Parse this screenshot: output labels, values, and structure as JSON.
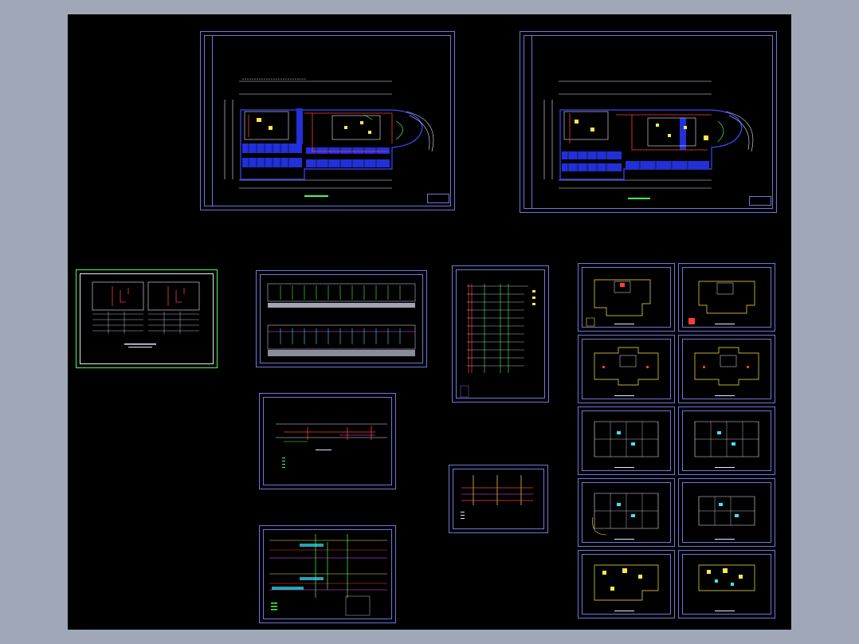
{
  "viewer": {
    "background": "#a0a8b7",
    "canvas_color": "#000000"
  },
  "colors": {
    "frame": "#6f78d6",
    "wall": "#3c48ff",
    "accent_yellow": "#ffe84a",
    "accent_red": "#ff3b3b",
    "accent_green": "#43ff55",
    "accent_cyan": "#39e6ff",
    "accent_magenta": "#ff4dff",
    "line_white": "#e8e8ff"
  },
  "sheets": [
    {
      "id": "floor-plan-a",
      "kind": "basement-floor-plan"
    },
    {
      "id": "floor-plan-b",
      "kind": "basement-floor-plan"
    },
    {
      "id": "system-diagram-green",
      "kind": "riser-diagram"
    },
    {
      "id": "schedule-table",
      "kind": "equipment-schedule"
    },
    {
      "id": "vertical-riser",
      "kind": "riser-diagram"
    },
    {
      "id": "section-detail",
      "kind": "section"
    },
    {
      "id": "small-detail",
      "kind": "detail"
    },
    {
      "id": "wiring-diagram",
      "kind": "wiring"
    },
    {
      "id": "tower-plan-grid",
      "kind": "typical-floor-plans",
      "count": 10
    }
  ]
}
